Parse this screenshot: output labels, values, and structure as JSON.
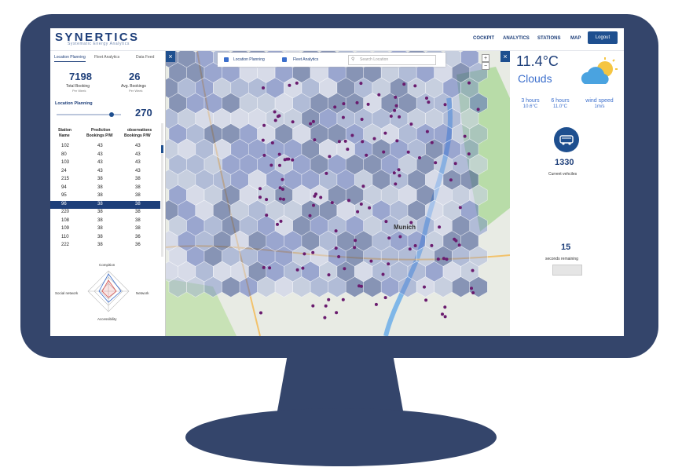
{
  "header": {
    "logo": "SYNERTICS",
    "logo_sub": "Systematic Energy Analytics",
    "nav": [
      "COCKPIT",
      "ANALYTICS",
      "STATIONS",
      "MAP"
    ],
    "logout": "Logout"
  },
  "left": {
    "tabs": [
      "Location Planning",
      "Fleet Analytics",
      "Data Feed"
    ],
    "total_booking": "7198",
    "total_booking_label": "Total Booking",
    "total_booking_sub": "Per Week",
    "avg_bookings": "26",
    "avg_bookings_label": "Avg. Bookings",
    "avg_bookings_sub": "Per Week",
    "location_planning_label": "Location Planning",
    "location_planning_value": "270",
    "slider_level": 0.85,
    "table": {
      "headers": [
        [
          "Station",
          "Name"
        ],
        [
          "Prediction",
          "Bookings P/W"
        ],
        [
          "observations",
          "Bookings P/W"
        ]
      ],
      "rows": [
        [
          "102",
          "43",
          "43"
        ],
        [
          "80",
          "43",
          "43"
        ],
        [
          "103",
          "43",
          "43"
        ],
        [
          "24",
          "43",
          "43"
        ],
        [
          "215",
          "38",
          "38"
        ],
        [
          "94",
          "38",
          "38"
        ],
        [
          "95",
          "38",
          "38"
        ],
        [
          "96",
          "38",
          "38"
        ],
        [
          "220",
          "38",
          "38"
        ],
        [
          "108",
          "38",
          "38"
        ],
        [
          "109",
          "38",
          "38"
        ],
        [
          "110",
          "38",
          "36"
        ],
        [
          "222",
          "38",
          "36"
        ]
      ],
      "selected_index": 7
    },
    "radar": {
      "labels": [
        "Compition",
        "Network",
        "Accessibility",
        "Social network"
      ]
    }
  },
  "map": {
    "layers": [
      "Location Planning",
      "Fleet Analytics"
    ],
    "search_placeholder": "Search Location",
    "city_label": "Munich",
    "zoom_in": "+",
    "zoom_out": "−",
    "close": "×"
  },
  "right": {
    "temperature": "11.4°C",
    "condition": "Clouds",
    "forecast": [
      {
        "label": "3 hours",
        "value": "10.6°C"
      },
      {
        "label": "6 hours",
        "value": "11.0°C"
      },
      {
        "label": "wind speed",
        "value": "1m/s"
      }
    ],
    "vehicles": "1330",
    "vehicles_label": "Current vehciles",
    "countdown": "15",
    "countdown_label": "seconds remaining",
    "close": "×"
  },
  "colors": {
    "monitor": "#34456b",
    "brand": "#1e3f7a",
    "accent": "#3b6ecc",
    "hex_fill": "#5b74c4",
    "points": "#6a1b6e"
  }
}
